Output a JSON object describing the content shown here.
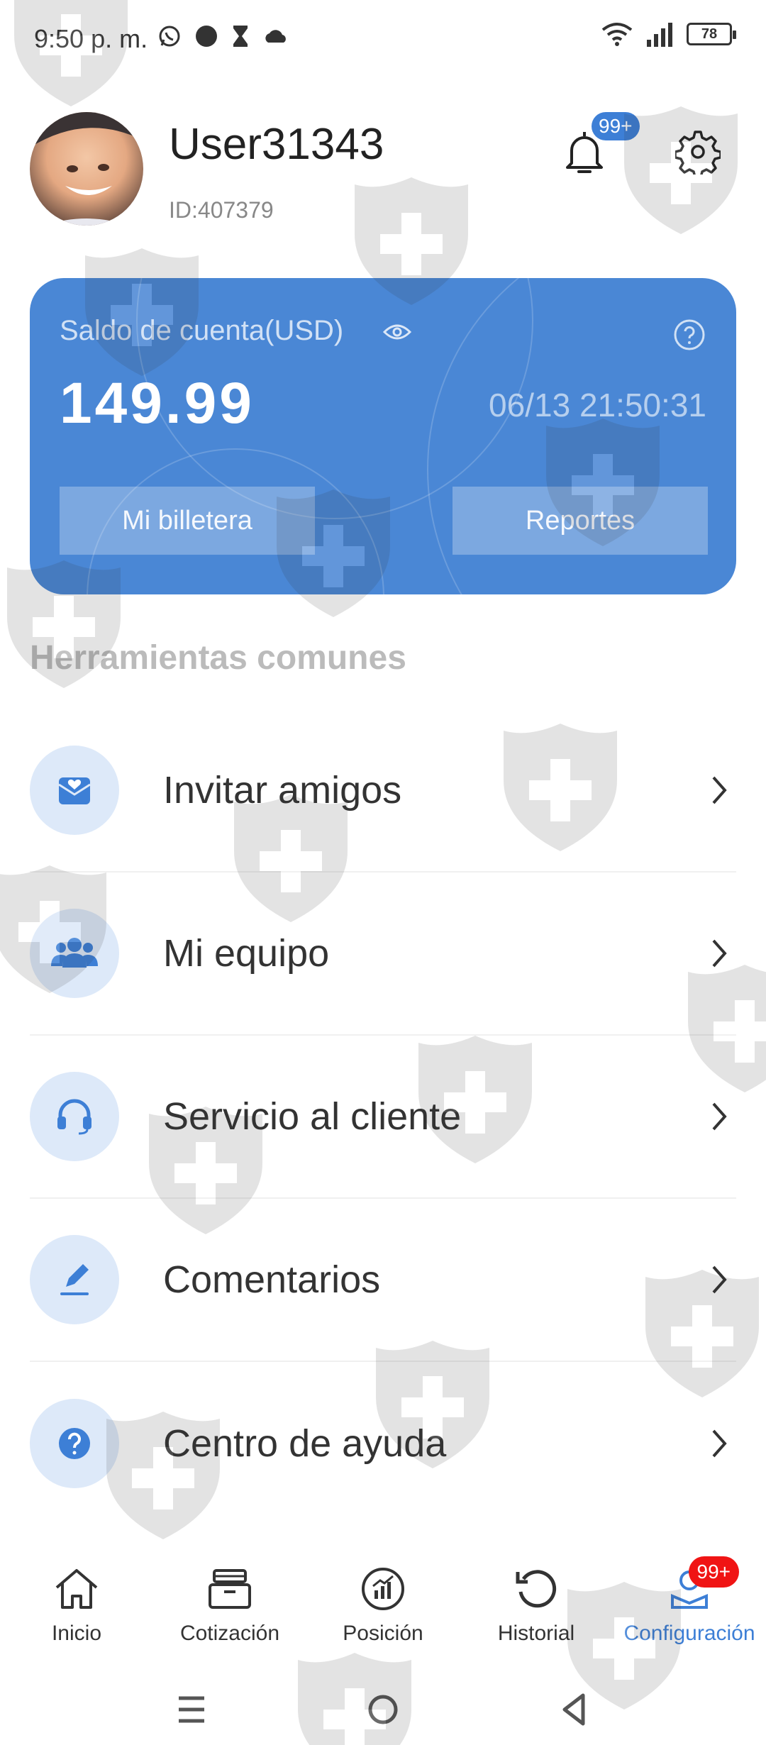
{
  "status_bar": {
    "time": "9:50 p. m.",
    "battery": "78",
    "icons_left": [
      "whatsapp-icon",
      "circle-icon",
      "hourglass-icon",
      "cloud-icon"
    ],
    "icons_right": [
      "wifi-icon",
      "signal-icon",
      "battery-icon"
    ]
  },
  "profile": {
    "username": "User31343",
    "user_id": "ID:407379",
    "notification_badge": "99+"
  },
  "balance_card": {
    "label": "Saldo de cuenta(USD)",
    "amount": "149.99",
    "timestamp": "06/13 21:50:31",
    "wallet_button": "Mi billetera",
    "reports_button": "Reportes",
    "color": "#4a87d5"
  },
  "section_title": "Herramientas comunes",
  "menu": [
    {
      "label": "Invitar amigos",
      "icon": "invite-icon"
    },
    {
      "label": "Mi equipo",
      "icon": "team-icon"
    },
    {
      "label": "Servicio al cliente",
      "icon": "headset-icon"
    },
    {
      "label": "Comentarios",
      "icon": "edit-icon"
    },
    {
      "label": "Centro de ayuda",
      "icon": "question-icon"
    }
  ],
  "bottom_nav": {
    "items": [
      {
        "label": "Inicio",
        "icon": "home-icon"
      },
      {
        "label": "Cotización",
        "icon": "quote-icon"
      },
      {
        "label": "Posición",
        "icon": "position-icon"
      },
      {
        "label": "Historial",
        "icon": "history-icon"
      },
      {
        "label": "Configuración",
        "icon": "profile-icon",
        "active": true,
        "badge": "99+"
      }
    ]
  },
  "colors": {
    "accent": "#3d7fd6",
    "badge_red": "#f01414",
    "icon_bg": "#dde9f9"
  }
}
